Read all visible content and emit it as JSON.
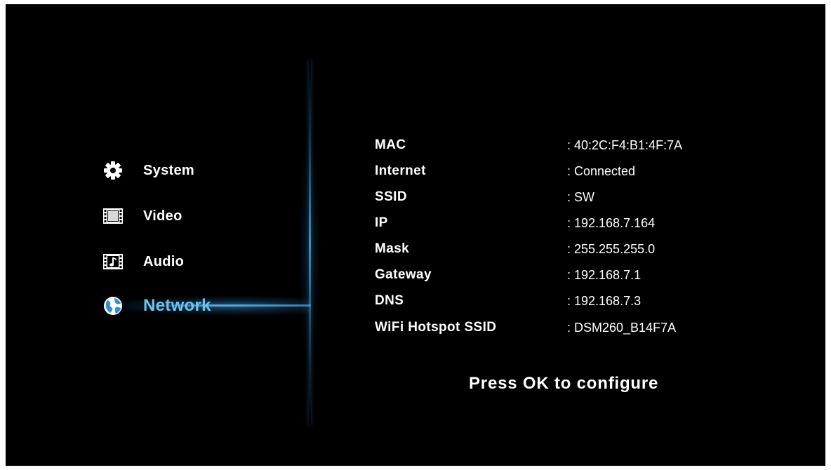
{
  "menu": {
    "items": [
      {
        "label": "System",
        "icon": "gear-icon"
      },
      {
        "label": "Video",
        "icon": "film-icon"
      },
      {
        "label": "Audio",
        "icon": "music-note-icon"
      },
      {
        "label": "Network",
        "icon": "globe-icon"
      }
    ],
    "active": "Network"
  },
  "network_info": {
    "rows": [
      {
        "key": "MAC",
        "value": ": 40:2C:F4:B1:4F:7A"
      },
      {
        "key": "Internet",
        "value": ": Connected"
      },
      {
        "key": "SSID",
        "value": ": SW"
      },
      {
        "key": "IP",
        "value": ": 192.168.7.164"
      },
      {
        "key": "Mask",
        "value": ": 255.255.255.0"
      },
      {
        "key": "Gateway",
        "value": ": 192.168.7.1"
      },
      {
        "key": "DNS",
        "value": ": 192.168.7.3"
      },
      {
        "key": "WiFi Hotspot SSID",
        "value": ": DSM260_B14F7A"
      }
    ]
  },
  "prompt": "Press OK to configure",
  "colors": {
    "background": "#000000",
    "text": "#ffffff",
    "accent": "#6ec3ee"
  }
}
